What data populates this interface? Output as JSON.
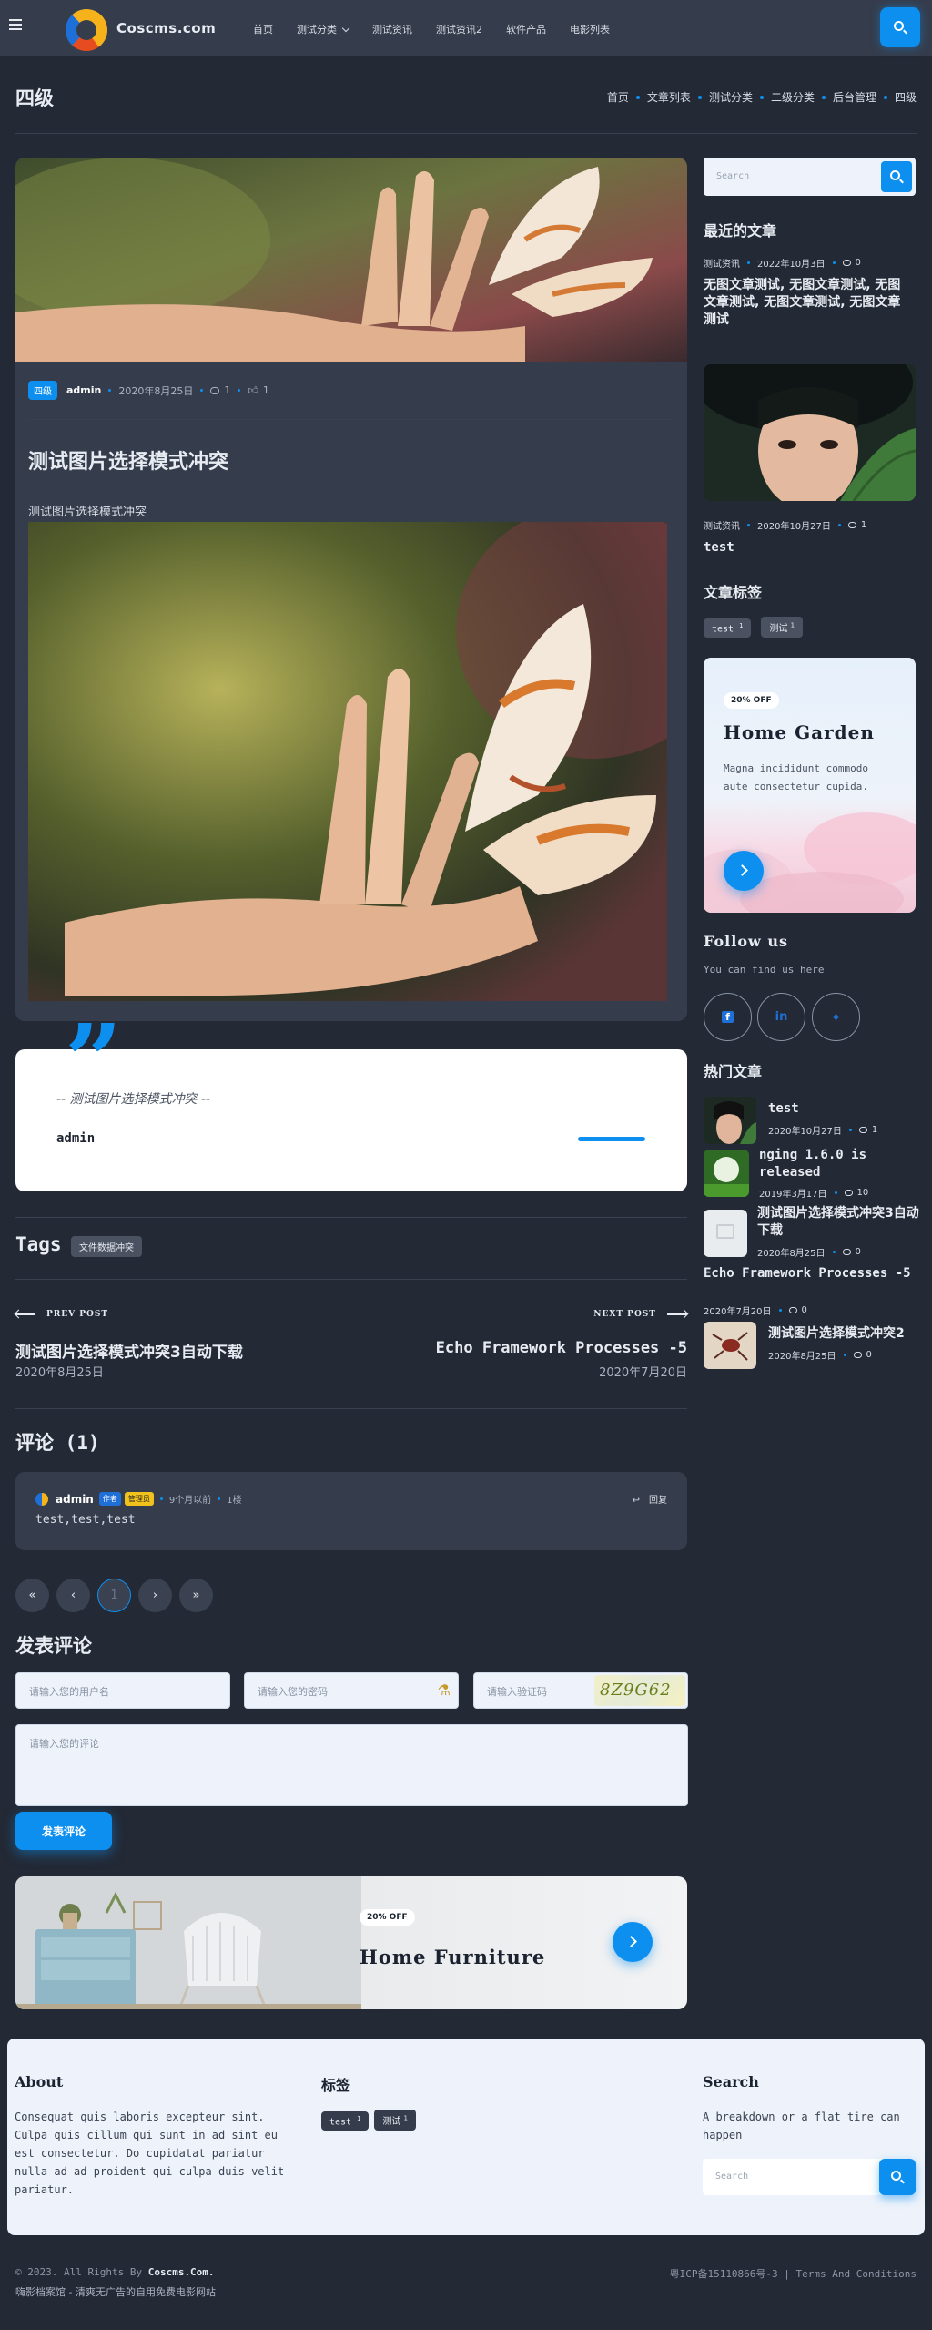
{
  "header": {
    "logo_text": "Coscms.com",
    "nav": [
      "首页",
      "测试分类",
      "测试资讯",
      "测试资讯2",
      "软件产品",
      "电影列表"
    ]
  },
  "page": {
    "title": "四级",
    "breadcrumbs": [
      "首页",
      "文章列表",
      "测试分类",
      "二级分类",
      "后台管理",
      "四级"
    ]
  },
  "article": {
    "category_badge": "四级",
    "author": "admin",
    "date": "2020年8月25日",
    "comments": "1",
    "likes": "1",
    "title": "测试图片选择模式冲突",
    "subtitle": "测试图片选择模式冲突"
  },
  "quote": {
    "text": "-- 测试图片选择模式冲突 --",
    "author": "admin"
  },
  "tags_section": {
    "heading": "Tags",
    "tags": [
      "文件数据冲突"
    ]
  },
  "post_nav": {
    "prev_label": "PREV POST",
    "prev_title": "测试图片选择模式冲突3自动下载",
    "prev_date": "2020年8月25日",
    "next_label": "NEXT POST",
    "next_title": "Echo Framework Processes -5",
    "next_date": "2020年7月20日"
  },
  "comments": {
    "heading": "评论 (1)",
    "items": [
      {
        "user": "admin",
        "badge_author": "作者",
        "badge_admin": "管理员",
        "time": "9个月以前",
        "floor": "1楼",
        "body": "test,test,test",
        "reply_label": "回复"
      }
    ],
    "pager": [
      "«",
      "‹",
      "1",
      "›",
      "»"
    ]
  },
  "comment_form": {
    "heading": "发表评论",
    "username_placeholder": "请输入您的用户名",
    "password_placeholder": "请输入您的密码",
    "captcha_placeholder": "请输入验证码",
    "captcha_text": "8Z9G62",
    "comment_placeholder": "请输入您的评论",
    "submit_label": "发表评论"
  },
  "promo_furniture": {
    "badge": "20% OFF",
    "title": "Home Furniture"
  },
  "sidebar": {
    "search_placeholder": "Search",
    "recent_heading": "最近的文章",
    "recent": [
      {
        "category": "测试资讯",
        "date": "2022年10月3日",
        "comments": "0",
        "title": "无图文章测试, 无图文章测试, 无图文章测试, 无图文章测试, 无图文章测试"
      },
      {
        "category": "测试资讯",
        "date": "2020年10月27日",
        "comments": "1",
        "title": "test"
      }
    ],
    "tags_heading": "文章标签",
    "tags": [
      {
        "label": "test",
        "count": "1"
      },
      {
        "label": "测试",
        "count": "1"
      }
    ],
    "garden": {
      "badge": "20% OFF",
      "title": "Home Garden",
      "text": "Magna incididunt commodo aute consectetur cupida."
    },
    "follow_heading": "Follow us",
    "follow_text": "You can find us here",
    "social_icons": [
      "facebook-icon",
      "linkedin-icon",
      "twitter-icon"
    ],
    "hot_heading": "热门文章",
    "hot": [
      {
        "title": "test",
        "date": "2020年10月27日",
        "comments": "1"
      },
      {
        "title": "nging 1.6.0 is released",
        "date": "2019年3月17日",
        "comments": "10"
      },
      {
        "title": "测试图片选择模式冲突3自动下载",
        "date": "2020年8月25日",
        "comments": "0"
      },
      {
        "title": "Echo Framework Processes -5",
        "date": "2020年7月20日",
        "comments": "0"
      },
      {
        "title": "测试图片选择模式冲突2",
        "date": "2020年8月25日",
        "comments": "0"
      }
    ]
  },
  "footer": {
    "about_heading": "About",
    "about_text": "Consequat quis laboris excepteur sint. Culpa quis cillum qui sunt in ad sint eu est consectetur. Do cupidatat pariatur nulla ad ad proident qui culpa duis velit pariatur.",
    "tags_heading": "标签",
    "tags": [
      {
        "label": "test",
        "count": "1"
      },
      {
        "label": "测试",
        "count": "1"
      }
    ],
    "search_heading": "Search",
    "search_text": "A breakdown or a flat tire can happen",
    "search_placeholder": "Search",
    "copyright_prefix": "© 2023. All Rights By",
    "copyright_site": "Coscms.Com.",
    "copyright_line2": "嗨影档案馆 - 清爽无广告的自用免费电影网站",
    "icp": "粤ICP备15110866号-3",
    "terms": "Terms And Conditions"
  }
}
